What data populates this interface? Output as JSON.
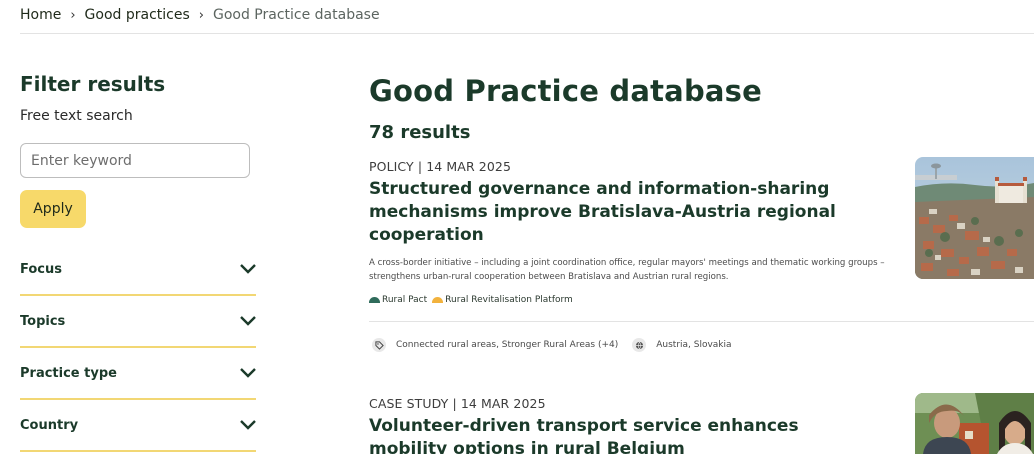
{
  "breadcrumb": {
    "home": "Home",
    "section": "Good practices",
    "current": "Good Practice database"
  },
  "sidebar": {
    "title": "Filter results",
    "search_label": "Free text search",
    "search_placeholder": "Enter keyword",
    "apply_label": "Apply",
    "facets": [
      "Focus",
      "Topics",
      "Practice type",
      "Country"
    ]
  },
  "main": {
    "title": "Good Practice database",
    "results": "78 results"
  },
  "cards": [
    {
      "meta": "POLICY | 14 MAR 2025",
      "title": "Structured governance and information-sharing mechanisms improve Bratislava-Austria regional cooperation",
      "description": "A cross-border initiative – including a joint coordination office, regular mayors' meetings and thematic working groups – strengthens urban-rural cooperation between Bratislava and Austrian rural regions.",
      "platforms": [
        {
          "label": "Rural Pact",
          "color": "#2f6b5b"
        },
        {
          "label": "Rural Revitalisation Platform",
          "color": "#f2b23d"
        }
      ],
      "topics": "Connected rural areas, Stronger Rural Areas (+4)",
      "countries": "Austria, Slovakia"
    },
    {
      "meta": "CASE STUDY | 14 MAR 2025",
      "title": "Volunteer-driven transport service enhances mobility options in rural Belgium"
    }
  ],
  "colors": {
    "accent_yellow": "#f7d96a",
    "heading_green": "#1b3a2a",
    "divider_yellow": "#f2d774"
  }
}
